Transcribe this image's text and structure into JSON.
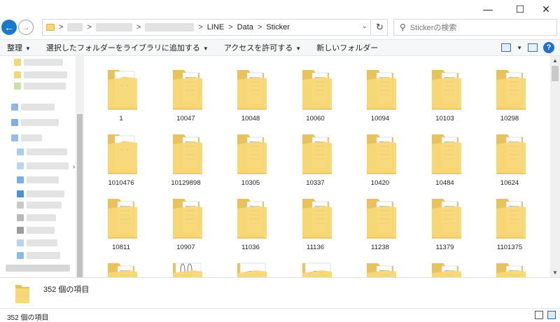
{
  "window": {
    "minimize": "—",
    "maximize": "☐",
    "close": "✕"
  },
  "address": {
    "back_icon": "arrow-left",
    "forward_icon": "arrow-right",
    "crumb_sep": ">",
    "crumbs": [
      "LINE",
      "Data",
      "Sticker"
    ],
    "refresh_icon": "↻",
    "dropdown_icon": "⌄",
    "search_placeholder": "Stickerの検索",
    "search_icon": "⚲"
  },
  "command_bar": {
    "organize": "整理",
    "add_to_library": "選択したフォルダーをライブラリに追加する",
    "share_access": "アクセスを許可する",
    "new_folder": "新しいフォルダー",
    "dropdown_arrow": "▼",
    "help": "?"
  },
  "colors": {
    "accent": "#1979ca",
    "folder_back": "#e9c25a",
    "folder_front": "#f8d775",
    "folder_dark": "#d7ab3a"
  },
  "folders": [
    {
      "name": "1",
      "thumb": "sticker"
    },
    {
      "name": "10047",
      "thumb": "docs"
    },
    {
      "name": "10048",
      "thumb": "docs"
    },
    {
      "name": "10060",
      "thumb": "docs"
    },
    {
      "name": "10094",
      "thumb": "docs"
    },
    {
      "name": "10103",
      "thumb": "docs"
    },
    {
      "name": "10298",
      "thumb": "docs"
    },
    {
      "name": "1010476",
      "thumb": "sticker2"
    },
    {
      "name": "10129898",
      "thumb": "docs"
    },
    {
      "name": "10305",
      "thumb": "docs"
    },
    {
      "name": "10337",
      "thumb": "docs"
    },
    {
      "name": "10420",
      "thumb": "docs"
    },
    {
      "name": "10484",
      "thumb": "docs"
    },
    {
      "name": "10624",
      "thumb": "docs"
    },
    {
      "name": "10811",
      "thumb": "docs"
    },
    {
      "name": "10907",
      "thumb": "docs"
    },
    {
      "name": "11036",
      "thumb": "docs"
    },
    {
      "name": "11136",
      "thumb": "docs"
    },
    {
      "name": "11238",
      "thumb": "docs"
    },
    {
      "name": "11379",
      "thumb": "docs"
    },
    {
      "name": "1101375",
      "thumb": "docs"
    },
    {
      "name": "",
      "thumb": "docs"
    },
    {
      "name": "",
      "thumb": "bunny"
    },
    {
      "name": "",
      "thumb": "sketch"
    },
    {
      "name": "",
      "thumb": "sketch2"
    },
    {
      "name": "",
      "thumb": "docs"
    },
    {
      "name": "",
      "thumb": "docs"
    },
    {
      "name": "",
      "thumb": "docs"
    }
  ],
  "details": {
    "count": "352 個の項目"
  },
  "status_bar": {
    "count": "352 個の項目"
  }
}
